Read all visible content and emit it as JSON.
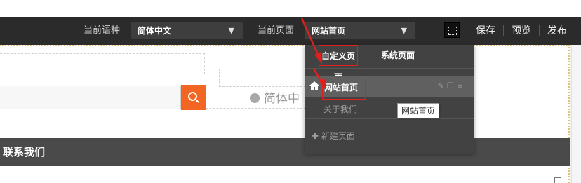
{
  "toolbar": {
    "language_label": "当前语种",
    "language_value": "简体中文",
    "page_label": "当前页面",
    "page_value": "网站首页",
    "save": "保存",
    "preview": "预览",
    "publish": "发布"
  },
  "canvas": {
    "language_indicator": "简体中",
    "contact_nav": "联系我们"
  },
  "page_menu": {
    "tabs": [
      {
        "label": "自定义页面",
        "active": true
      },
      {
        "label": "系统页面",
        "active": false
      }
    ],
    "pages": [
      {
        "label": "网站首页",
        "active": true,
        "tools": [
          "wrench-icon",
          "copy-icon",
          "link-icon"
        ]
      },
      {
        "label": "关于我们",
        "active": false
      }
    ],
    "new_page": "新建页面"
  },
  "tooltip": "网站首页",
  "colors": {
    "toolbar_bg": "#2b2b2b",
    "dropdown_bg": "#424242",
    "accent_orange": "#f26522",
    "highlight_red": "#e0201f",
    "contact_bar_bg": "#4a4a4a"
  }
}
